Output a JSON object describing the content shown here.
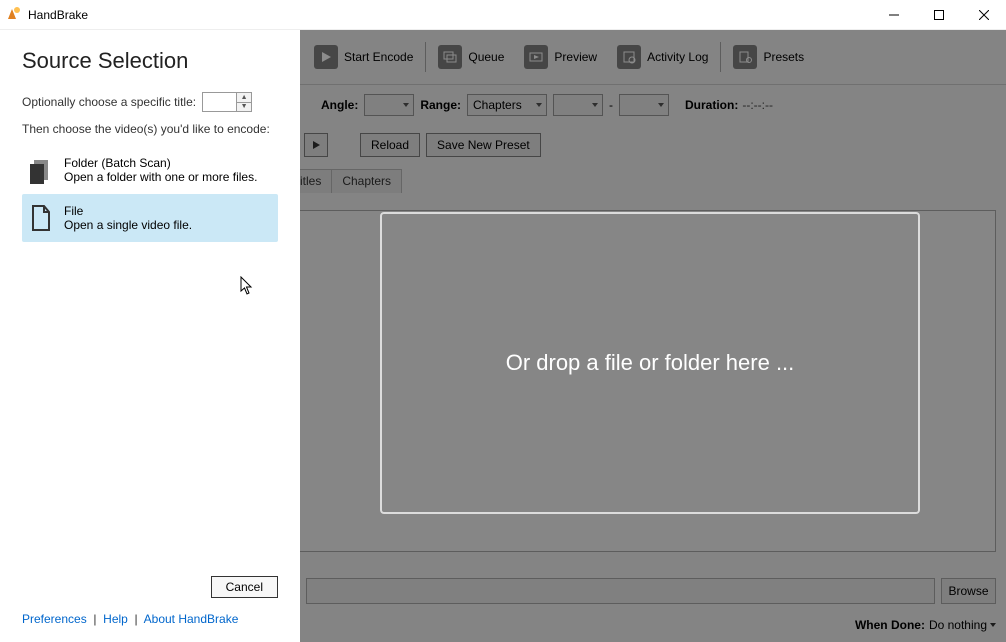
{
  "window": {
    "title": "HandBrake"
  },
  "toolbar": {
    "start_encode": "Start Encode",
    "queue": "Queue",
    "preview": "Preview",
    "activity_log": "Activity Log",
    "presets": "Presets"
  },
  "row2": {
    "angle": "Angle:",
    "range": "Range:",
    "range_value": "Chapters",
    "dash": "-",
    "duration": "Duration:",
    "duration_value": "--:--:--"
  },
  "row3": {
    "reload": "Reload",
    "save_new_preset": "Save New Preset"
  },
  "tabs": {
    "titles": "itles",
    "chapters": "Chapters"
  },
  "drop": {
    "text": "Or drop a file or folder here ..."
  },
  "browse": {
    "btn": "Browse"
  },
  "when_done": {
    "label": "When Done:",
    "value": "Do nothing"
  },
  "source": {
    "title": "Source Selection",
    "optional": "Optionally choose a specific title:",
    "then": "Then choose the video(s) you'd like to encode:",
    "folder": {
      "title": "Folder (Batch Scan)",
      "sub": "Open a folder with one or more files."
    },
    "file": {
      "title": "File",
      "sub": "Open a single video file."
    },
    "cancel": "Cancel",
    "links": {
      "prefs": "Preferences",
      "help": "Help",
      "about": "About HandBrake"
    }
  }
}
